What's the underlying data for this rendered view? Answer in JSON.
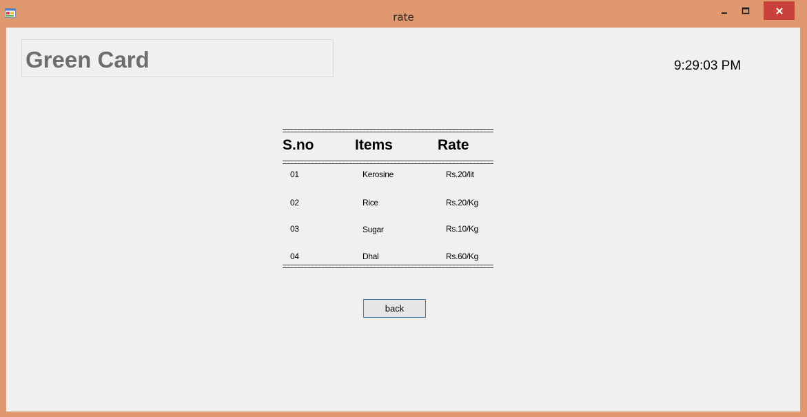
{
  "window": {
    "title": "rate",
    "controls": {
      "minimize": "–",
      "maximize": "☐",
      "close": "✕"
    }
  },
  "heading": "Green Card",
  "clock": "9:29:03 PM",
  "table": {
    "headers": [
      "S.no",
      "Items",
      "Rate"
    ],
    "rows": [
      [
        "01",
        "Kerosine",
        "Rs.20/lit"
      ],
      [
        "02",
        "Rice",
        "Rs.20/Kg"
      ],
      [
        "03",
        "Sugar",
        "Rs.10/Kg"
      ],
      [
        "04",
        "Dhal",
        "Rs.60/Kg"
      ]
    ]
  },
  "back_label": "back",
  "colors": {
    "frame": "#e0996f",
    "close": "#c8423b",
    "client": "#f0f0f0"
  }
}
